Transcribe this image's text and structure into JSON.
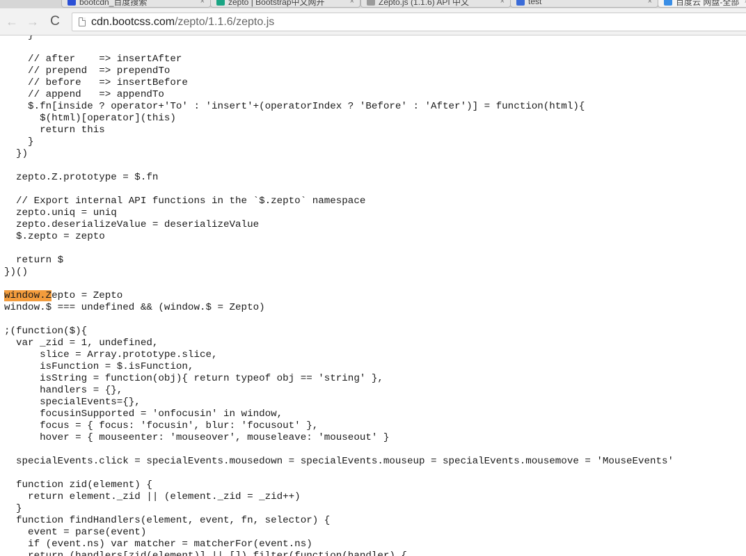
{
  "tabs": [
    {
      "title": "bootcdn_百度搜索",
      "favicon_color": "#2a4fd6",
      "active": false
    },
    {
      "title": "zepto | Bootstrap中文网开",
      "favicon_color": "#1aa584",
      "active": false
    },
    {
      "title": "Zepto.js (1.1.6) API 中文",
      "favicon_color": "#9a9a9a",
      "active": false
    },
    {
      "title": "test",
      "favicon_color": "#3a6bd8",
      "active": false
    },
    {
      "title": "百度云 网盘-全部",
      "favicon_color": "#3a8ee6",
      "active": true
    }
  ],
  "toolbar": {
    "back_icon": "←",
    "forward_icon": "→",
    "reload_icon": "C"
  },
  "address": {
    "host": "cdn.bootcss.com",
    "path": "/zepto/1.1.6/zepto.js"
  },
  "find_highlight": "window.Z",
  "code_lines": [
    "    }",
    "",
    "    // after    => insertAfter",
    "    // prepend  => prependTo",
    "    // before   => insertBefore",
    "    // append   => appendTo",
    "    $.fn[inside ? operator+'To' : 'insert'+(operatorIndex ? 'Before' : 'After')] = function(html){",
    "      $(html)[operator](this)",
    "      return this",
    "    }",
    "  })",
    "",
    "  zepto.Z.prototype = $.fn",
    "",
    "  // Export internal API functions in the `$.zepto` namespace",
    "  zepto.uniq = uniq",
    "  zepto.deserializeValue = deserializeValue",
    "  $.zepto = zepto",
    "",
    "  return $",
    "})()",
    "",
    "window.Zepto = Zepto",
    "window.$ === undefined && (window.$ = Zepto)",
    "",
    ";(function($){",
    "  var _zid = 1, undefined,",
    "      slice = Array.prototype.slice,",
    "      isFunction = $.isFunction,",
    "      isString = function(obj){ return typeof obj == 'string' },",
    "      handlers = {},",
    "      specialEvents={},",
    "      focusinSupported = 'onfocusin' in window,",
    "      focus = { focus: 'focusin', blur: 'focusout' },",
    "      hover = { mouseenter: 'mouseover', mouseleave: 'mouseout' }",
    "",
    "  specialEvents.click = specialEvents.mousedown = specialEvents.mouseup = specialEvents.mousemove = 'MouseEvents'",
    "",
    "  function zid(element) {",
    "    return element._zid || (element._zid = _zid++)",
    "  }",
    "  function findHandlers(element, event, fn, selector) {",
    "    event = parse(event)",
    "    if (event.ns) var matcher = matcherFor(event.ns)",
    "    return (handlers[zid(element)] || []).filter(function(handler) {"
  ]
}
